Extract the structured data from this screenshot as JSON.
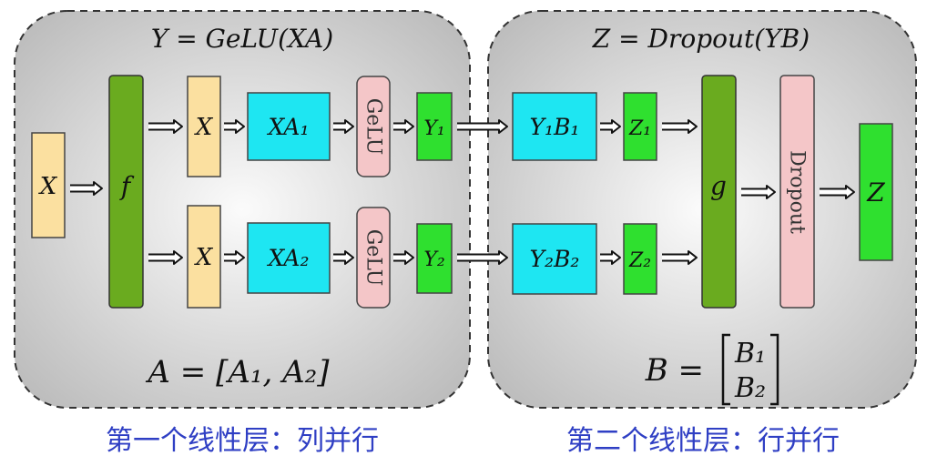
{
  "panels": [
    {
      "title": "Y = GeLU(XA)",
      "formula": "A = [A₁, A₂]",
      "caption": "第一个线性层：列并行"
    },
    {
      "title": "Z = Dropout(YB)",
      "formula_lhs": "B =",
      "formula_b1": "B₁",
      "formula_b2": "B₂",
      "caption": "第二个线性层：行并行"
    }
  ],
  "nodes": {
    "input_x": "X",
    "f": "f",
    "x_top": "X",
    "x_bottom": "X",
    "xa1": "XA₁",
    "xa2": "XA₂",
    "gelu_top": "GeLU",
    "gelu_bottom": "GeLU",
    "y1": "Y₁",
    "y2": "Y₂",
    "y1b1": "Y₁B₁",
    "y2b2": "Y₂B₂",
    "z1": "Z₁",
    "z2": "Z₂",
    "g": "g",
    "dropout": "Dropout",
    "z_out": "Z"
  },
  "colors": {
    "input_yellow": "#fbe0a0",
    "green_dark": "#6aab1f",
    "cyan": "#1ee6f2",
    "pink": "#f4c6c8",
    "green_bright": "#2fe02f",
    "caption_blue": "#2f3fc4",
    "panel_gray": "#d9d9d9"
  }
}
